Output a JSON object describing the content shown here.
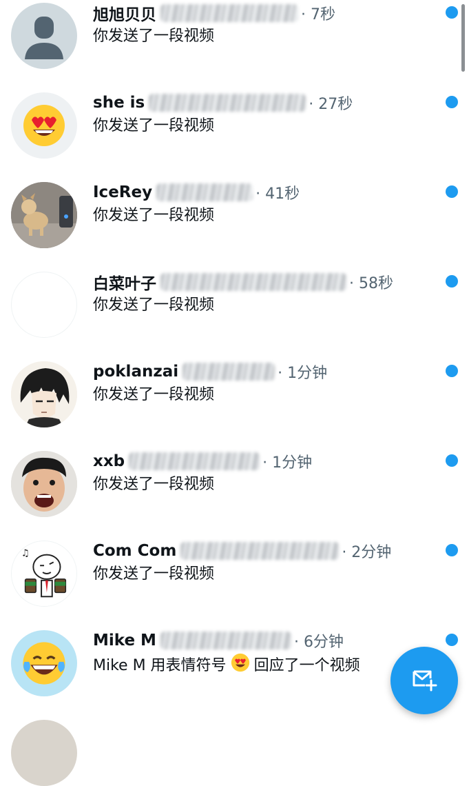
{
  "conversations": [
    {
      "name": "旭旭贝贝",
      "time": "· 7秒",
      "preview": "你发送了一段视频",
      "avatar": "default-avatar-icon"
    },
    {
      "name": "she is",
      "time": "· 27秒",
      "preview": "你发送了一段视频",
      "avatar": "heart-eyes-emoji-avatar"
    },
    {
      "name": "IceRey",
      "time": "· 41秒",
      "preview": "你发送了一段视频",
      "avatar": "dog-photo-avatar"
    },
    {
      "name": "白菜叶子",
      "time": "· 58秒",
      "preview": "你发送了一段视频",
      "avatar": "blank-white-avatar"
    },
    {
      "name": "poklanzai",
      "time": "· 1分钟",
      "preview": "你发送了一段视频",
      "avatar": "anime-character-avatar"
    },
    {
      "name": "xxb",
      "time": "· 1分钟",
      "preview": "你发送了一段视频",
      "avatar": "screaming-face-photo-avatar"
    },
    {
      "name": "Com Com",
      "time": "· 2分钟",
      "preview": "你发送了一段视频",
      "avatar": "cartoon-coffee-avatar"
    },
    {
      "name": "Mike M",
      "time": "· 6分钟",
      "preview_prefix": "Mike M 用表情符号",
      "preview_suffix": "回应了一个视频",
      "avatar": "laughing-tears-emoji-avatar"
    }
  ],
  "colors": {
    "accent": "#1d9bf0",
    "text_primary": "#0f1419",
    "text_secondary": "#536471"
  },
  "fab": {
    "icon": "new-message-icon"
  }
}
